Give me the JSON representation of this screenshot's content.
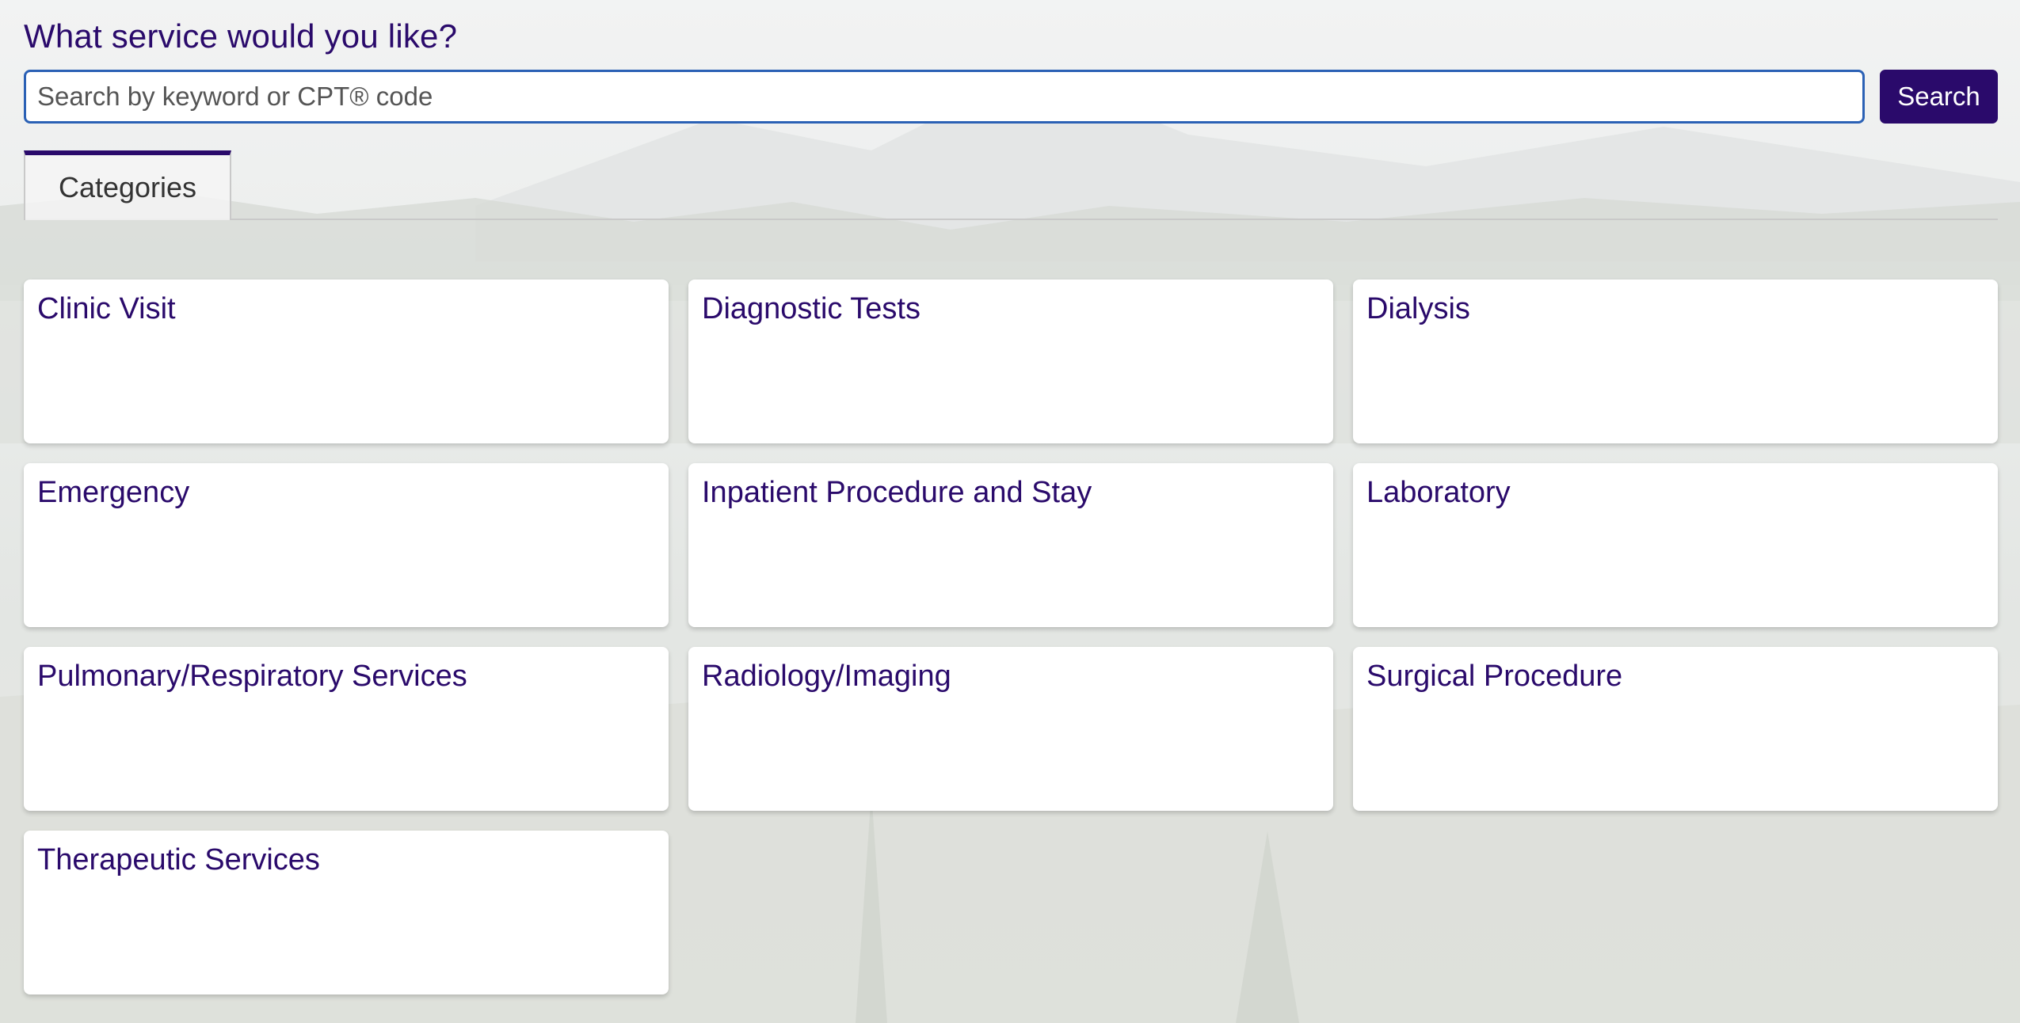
{
  "header": {
    "title": "What service would you like?"
  },
  "search": {
    "placeholder": "Search by keyword or CPT® code",
    "value": "",
    "button_label": "Search"
  },
  "tabs": [
    {
      "label": "Categories",
      "active": true
    }
  ],
  "categories": [
    {
      "label": "Clinic Visit"
    },
    {
      "label": "Diagnostic Tests"
    },
    {
      "label": "Dialysis"
    },
    {
      "label": "Emergency"
    },
    {
      "label": "Inpatient Procedure and Stay"
    },
    {
      "label": "Laboratory"
    },
    {
      "label": "Pulmonary/Respiratory Services"
    },
    {
      "label": "Radiology/Imaging"
    },
    {
      "label": "Surgical Procedure"
    },
    {
      "label": "Therapeutic Services"
    }
  ],
  "colors": {
    "brand": "#2a0a6b",
    "input_border": "#2b61b5",
    "card_bg": "#ffffff"
  }
}
